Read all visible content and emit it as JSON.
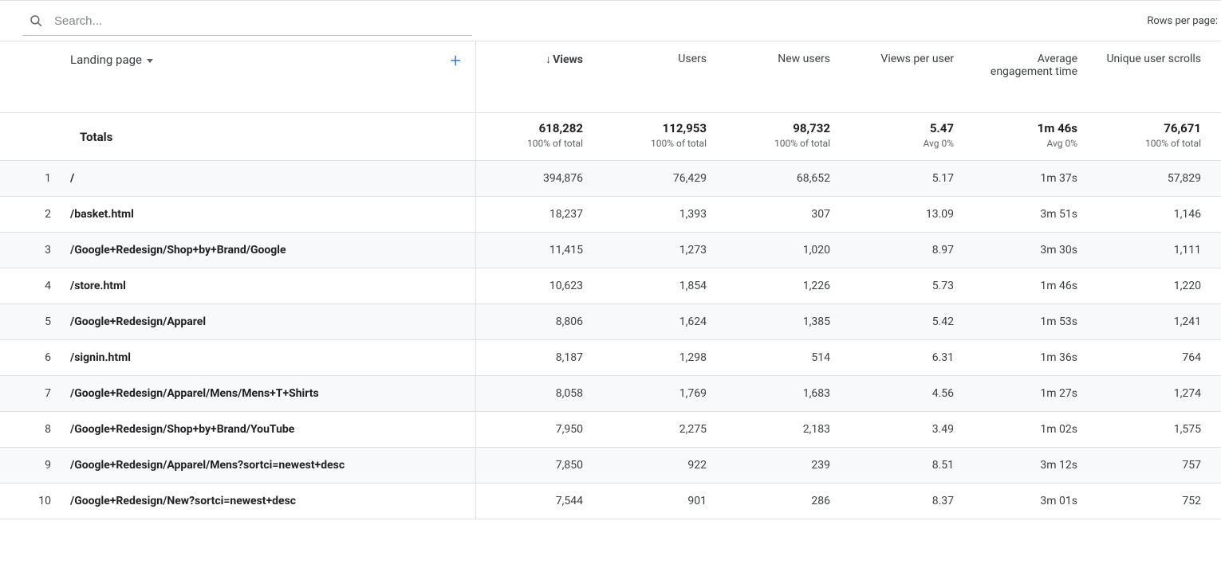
{
  "search": {
    "placeholder": "Search..."
  },
  "pager": {
    "rows_per_page_label": "Rows per page:"
  },
  "dimension": {
    "label": "Landing page"
  },
  "columns": [
    {
      "label": "Views",
      "sorted": true
    },
    {
      "label": "Users",
      "sorted": false
    },
    {
      "label": "New users",
      "sorted": false
    },
    {
      "label": "Views per user",
      "sorted": false
    },
    {
      "label": "Average engagement time",
      "sorted": false
    },
    {
      "label": "Unique user scrolls",
      "sorted": false
    }
  ],
  "totals": {
    "label": "Totals",
    "cells": [
      {
        "value": "618,282",
        "sub": "100% of total"
      },
      {
        "value": "112,953",
        "sub": "100% of total"
      },
      {
        "value": "98,732",
        "sub": "100% of total"
      },
      {
        "value": "5.47",
        "sub": "Avg 0%"
      },
      {
        "value": "1m 46s",
        "sub": "Avg 0%"
      },
      {
        "value": "76,671",
        "sub": "100% of total"
      }
    ]
  },
  "rows": [
    {
      "idx": "1",
      "dim": "/",
      "cells": [
        "394,876",
        "76,429",
        "68,652",
        "5.17",
        "1m 37s",
        "57,829"
      ]
    },
    {
      "idx": "2",
      "dim": "/basket.html",
      "cells": [
        "18,237",
        "1,393",
        "307",
        "13.09",
        "3m 51s",
        "1,146"
      ]
    },
    {
      "idx": "3",
      "dim": "/Google+Redesign/Shop+by+Brand/Google",
      "cells": [
        "11,415",
        "1,273",
        "1,020",
        "8.97",
        "3m 30s",
        "1,111"
      ]
    },
    {
      "idx": "4",
      "dim": "/store.html",
      "cells": [
        "10,623",
        "1,854",
        "1,226",
        "5.73",
        "1m 46s",
        "1,220"
      ]
    },
    {
      "idx": "5",
      "dim": "/Google+Redesign/Apparel",
      "cells": [
        "8,806",
        "1,624",
        "1,385",
        "5.42",
        "1m 53s",
        "1,241"
      ]
    },
    {
      "idx": "6",
      "dim": "/signin.html",
      "cells": [
        "8,187",
        "1,298",
        "514",
        "6.31",
        "1m 36s",
        "764"
      ]
    },
    {
      "idx": "7",
      "dim": "/Google+Redesign/Apparel/Mens/Mens+T+Shirts",
      "cells": [
        "8,058",
        "1,769",
        "1,683",
        "4.56",
        "1m 27s",
        "1,274"
      ]
    },
    {
      "idx": "8",
      "dim": "/Google+Redesign/Shop+by+Brand/YouTube",
      "cells": [
        "7,950",
        "2,275",
        "2,183",
        "3.49",
        "1m 02s",
        "1,575"
      ]
    },
    {
      "idx": "9",
      "dim": "/Google+Redesign/Apparel/Mens?sortci=newest+desc",
      "cells": [
        "7,850",
        "922",
        "239",
        "8.51",
        "3m 12s",
        "757"
      ]
    },
    {
      "idx": "10",
      "dim": "/Google+Redesign/New?sortci=newest+desc",
      "cells": [
        "7,544",
        "901",
        "286",
        "8.37",
        "3m 01s",
        "752"
      ]
    }
  ]
}
